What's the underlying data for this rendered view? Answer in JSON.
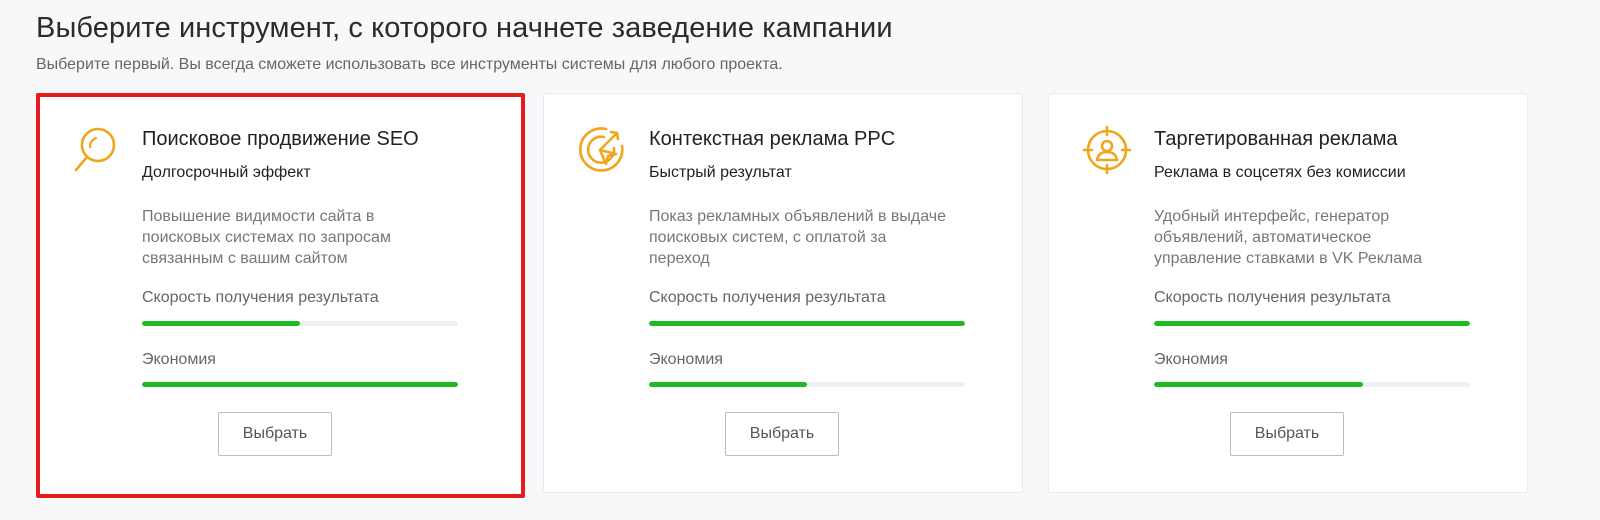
{
  "page": {
    "title": "Выберите инструмент, с которого начнете заведение кампании",
    "subtitle": "Выберите первый. Вы всегда сможете использовать все инструменты системы для любого проекта."
  },
  "colors": {
    "accent_icon": "#f0a51a",
    "bar_fill": "#1fba1f",
    "bar_track": "#edf0f4",
    "selection_border": "#e61b1b"
  },
  "metric_labels": {
    "speed": "Скорость получения результата",
    "economy": "Экономия"
  },
  "cards": [
    {
      "icon": "magnifier-icon",
      "title": "Поисковое продвижение SEO",
      "tagline": "Долгосрочный эффект",
      "description": "Повышение видимости сайта в поисковых системах по запросам связанным с вашим сайтом",
      "speed": 0.5,
      "economy": 1.0,
      "button": "Выбрать",
      "selected": true
    },
    {
      "icon": "target-click-icon",
      "title": "Контекстная реклама PPC",
      "tagline": "Быстрый результат",
      "description": "Показ рекламных объявлений в выдаче поисковых систем, с оплатой за переход",
      "speed": 1.0,
      "economy": 0.5,
      "button": "Выбрать",
      "selected": false
    },
    {
      "icon": "crosshair-user-icon",
      "title": "Таргетированная реклама",
      "tagline": "Реклама в соцсетях без комиссии",
      "description": "Удобный интерфейс, генератор объявлений, автоматическое управление ставками в VK Реклама",
      "speed": 1.0,
      "economy": 0.66,
      "button": "Выбрать",
      "selected": false
    }
  ]
}
